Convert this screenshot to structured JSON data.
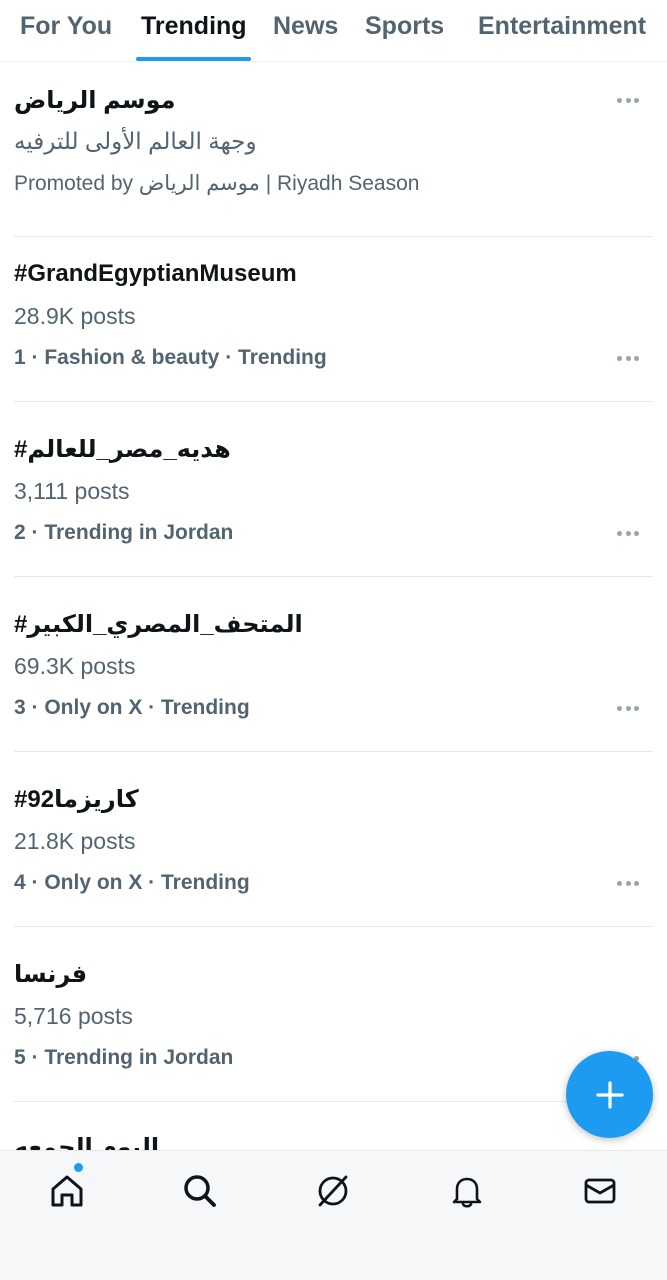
{
  "tabs": [
    {
      "label": "For You"
    },
    {
      "label": "Trending"
    },
    {
      "label": "News"
    },
    {
      "label": "Sports"
    },
    {
      "label": "Entertainment"
    }
  ],
  "active_tab": "Trending",
  "trends": [
    {
      "title": "موسم الرياض",
      "subtitle": "وجهة العالم الأولى للترفيه",
      "meta": "Promoted by موسم الرياض | Riyadh Season",
      "promoted": true
    },
    {
      "title": "#GrandEgyptianMuseum",
      "posts": "28.9K posts",
      "meta": "1 · Fashion & beauty · Trending"
    },
    {
      "title": "#هديه_مصر_للعالم",
      "posts": "3,111 posts",
      "meta": "2 · Trending in Jordan"
    },
    {
      "title": "#المتحف_المصري_الكبير",
      "posts": "69.3K posts",
      "meta": "3 · Only on X · Trending"
    },
    {
      "title": "#كاريزما92",
      "posts": "21.8K posts",
      "meta": "4 · Only on X · Trending"
    },
    {
      "title": "فرنسا",
      "posts": "5,716 posts",
      "meta": "5 · Trending in Jordan"
    },
    {
      "title": "اليوم الجمعه"
    }
  ],
  "bottom_nav": [
    {
      "icon": "home-icon",
      "has_notification": true
    },
    {
      "icon": "search-icon"
    },
    {
      "icon": "grok-icon"
    },
    {
      "icon": "bell-icon"
    },
    {
      "icon": "mail-icon"
    }
  ],
  "fab": {
    "icon": "plus-icon"
  },
  "colors": {
    "accent": "#1d9bf0",
    "text_primary": "#0f1419",
    "text_secondary": "#536471",
    "divider": "#e5e9ea"
  }
}
